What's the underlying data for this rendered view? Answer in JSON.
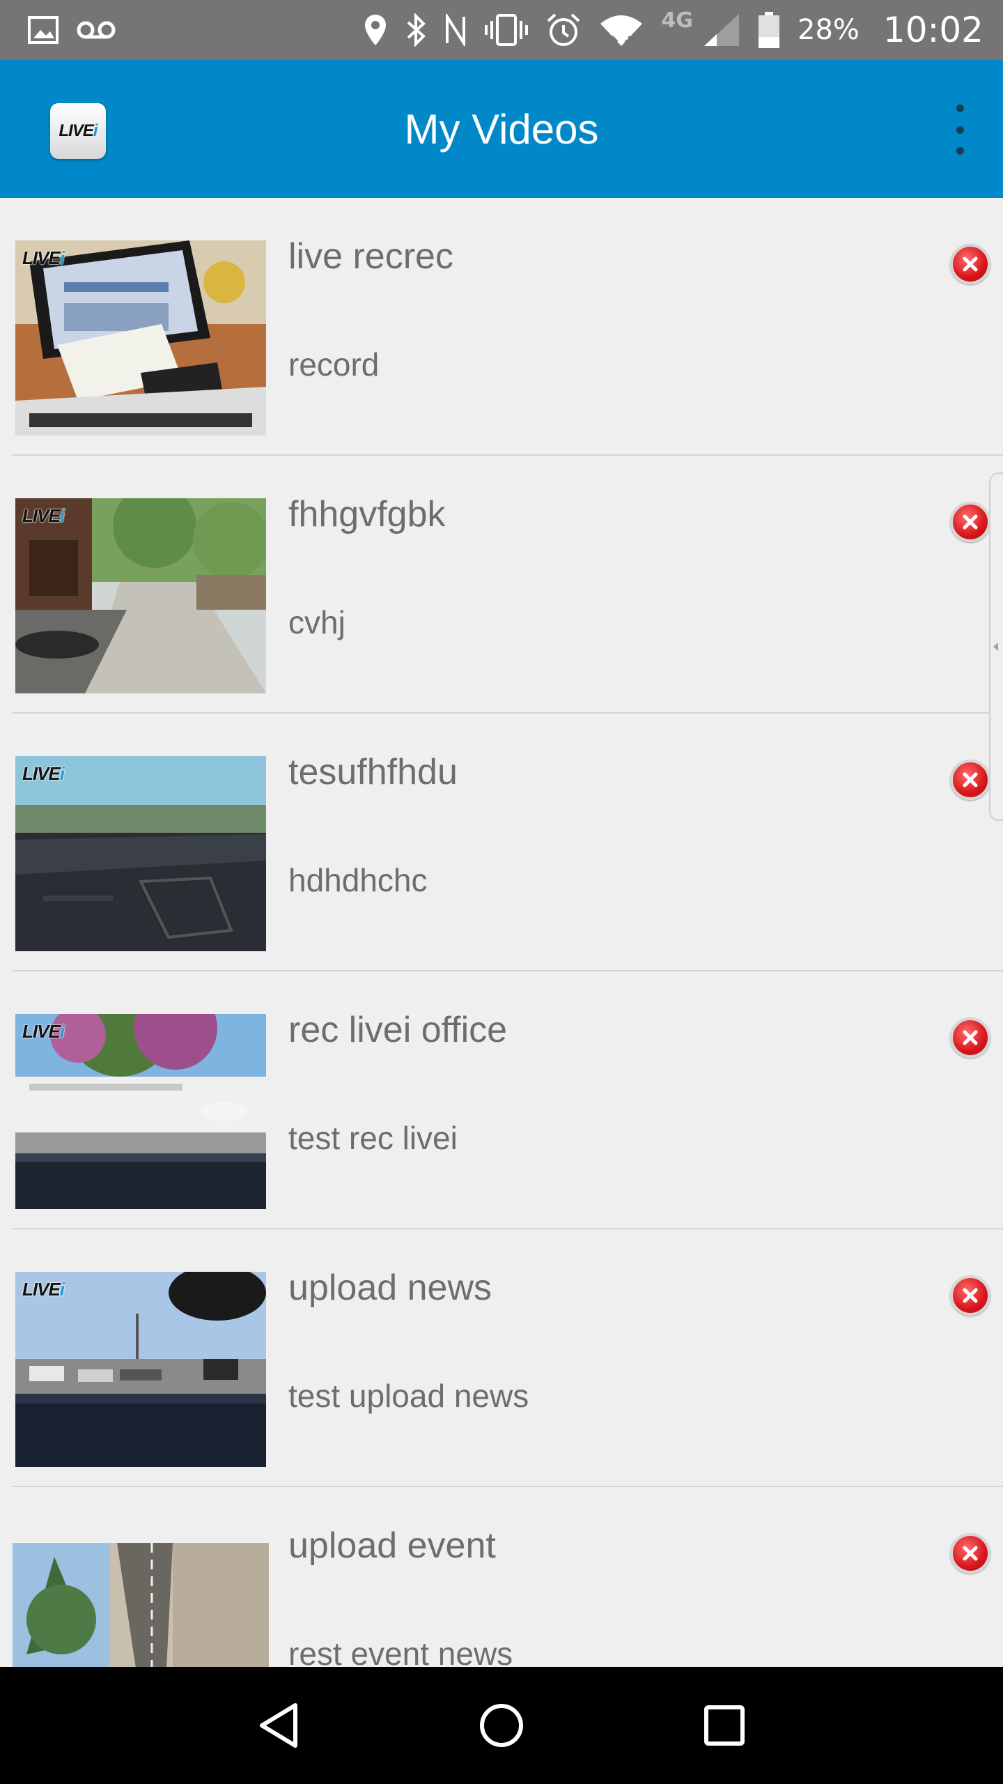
{
  "status_bar": {
    "battery": "28%",
    "time": "10:02",
    "network": "4G",
    "icons": [
      "image-icon",
      "voicemail-icon",
      "location-icon",
      "bluetooth-icon",
      "nfc-icon",
      "vibrate-icon",
      "alarm-icon",
      "wifi-icon",
      "signal-icon",
      "battery-icon"
    ]
  },
  "app_bar": {
    "title": "My Videos",
    "logo_text": "LIVE",
    "logo_accent": "i",
    "menu_icon": "overflow-menu-icon",
    "color": "#0088c8"
  },
  "videos": [
    {
      "title": "live recrec",
      "description": "record",
      "badge": true
    },
    {
      "title": "fhhgvfgbk",
      "description": "cvhj",
      "badge": true
    },
    {
      "title": "tesufhfhdu",
      "description": "hdhdhchc",
      "badge": true
    },
    {
      "title": "rec livei office",
      "description": "test rec livei",
      "badge": true
    },
    {
      "title": "upload news",
      "description": "test upload news",
      "badge": true
    },
    {
      "title": "upload event",
      "description": "rest event news",
      "badge": false
    }
  ],
  "delete_icon": "delete-icon",
  "nav_bar": {
    "icons": [
      "back-icon",
      "home-icon",
      "recents-icon"
    ]
  }
}
